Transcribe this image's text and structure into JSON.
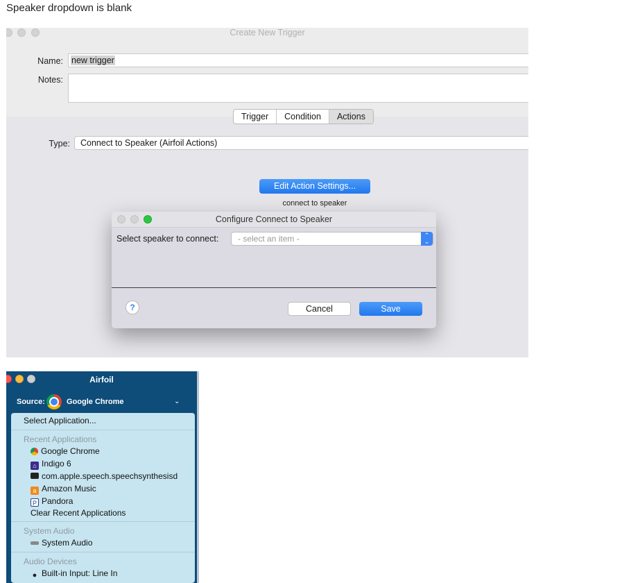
{
  "caption": "Speaker dropdown is blank",
  "trigger_window": {
    "title": "Create New Trigger",
    "name_label": "Name:",
    "name_value": "new trigger",
    "notes_label": "Notes:",
    "tabs": [
      {
        "label": "Trigger",
        "selected": false
      },
      {
        "label": "Condition",
        "selected": false
      },
      {
        "label": "Actions",
        "selected": true
      }
    ],
    "type_label": "Type:",
    "type_value": "Connect to Speaker (Airfoil Actions)",
    "edit_button_label": "Edit Action Settings...",
    "edit_caption": "connect to speaker"
  },
  "dialog": {
    "title": "Configure Connect to Speaker",
    "speaker_label": "Select speaker to connect:",
    "speaker_placeholder": "- select an item -",
    "help_label": "?",
    "cancel_label": "Cancel",
    "save_label": "Save"
  },
  "airfoil": {
    "title": "Airfoil",
    "source_label": "Source:",
    "source_value": "Google Chrome",
    "menu": {
      "select_app": "Select Application...",
      "recent_header": "Recent Applications",
      "recent_items": [
        {
          "label": "Google Chrome",
          "icon": "chrome-icon"
        },
        {
          "label": "Indigo 6",
          "icon": "indigo-icon"
        },
        {
          "label": "com.apple.speech.speechsynthesisd",
          "icon": "terminal-icon"
        },
        {
          "label": "Amazon Music",
          "icon": "amazon-music-icon"
        },
        {
          "label": "Pandora",
          "icon": "pandora-icon"
        }
      ],
      "clear_recent": "Clear Recent Applications",
      "system_header": "System Audio",
      "system_item": "System Audio",
      "devices_header": "Audio Devices",
      "device_item": "Built-in Input: Line In"
    }
  },
  "colors": {
    "accent": "#2a7ff0",
    "airfoil_bg": "#0e4c79",
    "menu_bg": "#c7e5f0"
  }
}
